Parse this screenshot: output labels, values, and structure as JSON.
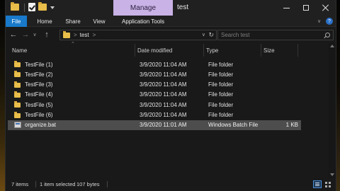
{
  "titlebar": {
    "manage_label": "Manage",
    "title": "test"
  },
  "ribbon": {
    "tabs": [
      "File",
      "Home",
      "Share",
      "View",
      "Application Tools"
    ],
    "active_tab_color": "#1979ca",
    "contextual_tab_color": "#c9b2e6"
  },
  "address": {
    "path_segment": "test",
    "search_placeholder": "Search test"
  },
  "columns": [
    "Name",
    "Date modified",
    "Type",
    "Size"
  ],
  "files": [
    {
      "name": "TestFile (1)",
      "date": "3/9/2020 11:04 AM",
      "type": "File folder",
      "size": "",
      "icon": "folder-icon",
      "selected": false
    },
    {
      "name": "TestFile (2)",
      "date": "3/9/2020 11:04 AM",
      "type": "File folder",
      "size": "",
      "icon": "folder-icon",
      "selected": false
    },
    {
      "name": "TestFile (3)",
      "date": "3/9/2020 11:04 AM",
      "type": "File folder",
      "size": "",
      "icon": "folder-icon",
      "selected": false
    },
    {
      "name": "TestFile (4)",
      "date": "3/9/2020 11:04 AM",
      "type": "File folder",
      "size": "",
      "icon": "folder-icon",
      "selected": false
    },
    {
      "name": "TestFile (5)",
      "date": "3/9/2020 11:04 AM",
      "type": "File folder",
      "size": "",
      "icon": "folder-icon",
      "selected": false
    },
    {
      "name": "TestFile (6)",
      "date": "3/9/2020 11:04 AM",
      "type": "File folder",
      "size": "",
      "icon": "folder-icon",
      "selected": false
    },
    {
      "name": "organize.bat",
      "date": "3/9/2020 11:01 AM",
      "type": "Windows Batch File",
      "size": "1 KB",
      "icon": "batch-file-icon",
      "selected": true
    }
  ],
  "status": {
    "item_count": "7 items",
    "selection": "1 item selected",
    "size": "107 bytes"
  }
}
